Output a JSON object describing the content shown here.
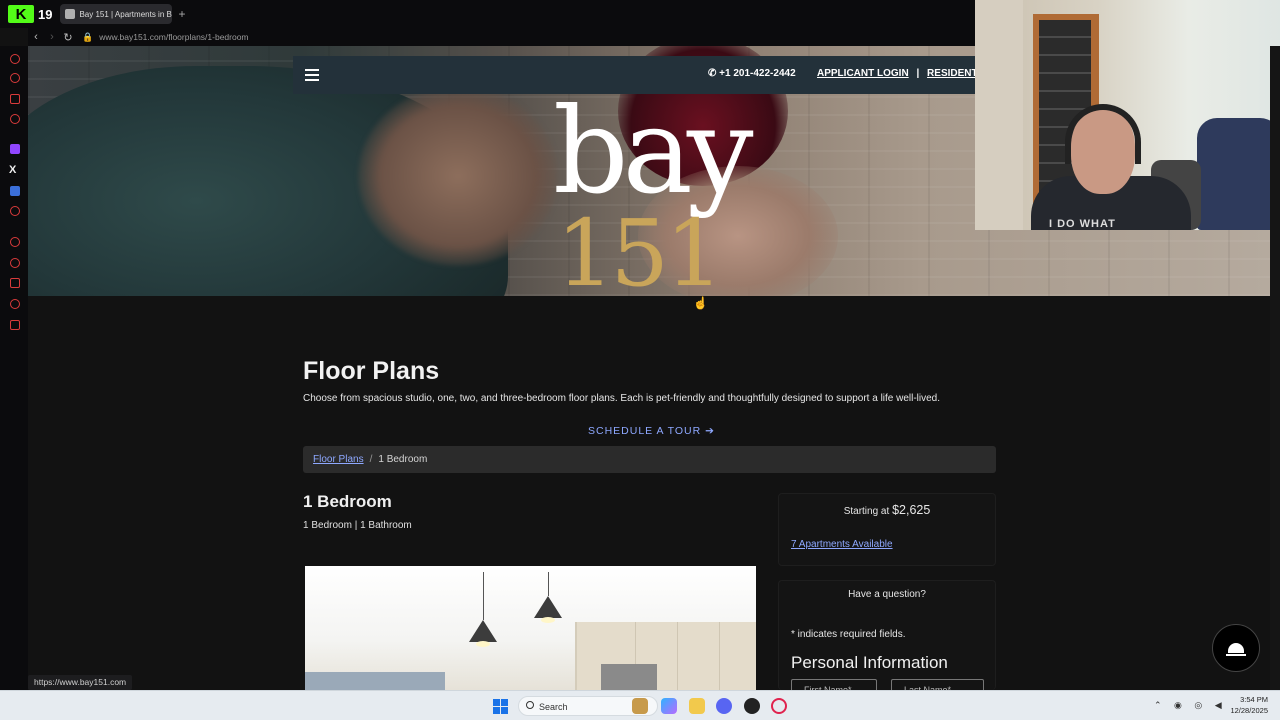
{
  "browser": {
    "kick_count": "19",
    "tab_title": "Bay 151 | Apartments in Be",
    "url": "www.bay151.com/floorplans/1-bedroom",
    "status_url": "https://www.bay151.com"
  },
  "header": {
    "phone": "+1 201-422-2442",
    "applicant_login": "APPLICANT LOGIN",
    "separator": "|",
    "resident_login": "RESIDENT LO"
  },
  "logo": {
    "word": "bay",
    "number": "151",
    "gold_color": "#c9a55a"
  },
  "page": {
    "title": "Floor Plans",
    "description": "Choose from spacious studio, one, two, and three-bedroom floor plans. Each is pet-friendly and thoughtfully designed to support a life well-lived.",
    "tour_button": "SCHEDULE A TOUR",
    "tour_arrow": "➔"
  },
  "breadcrumb": {
    "parent": "Floor Plans",
    "separator": "/",
    "current": "1 Bedroom"
  },
  "unit": {
    "title": "1 Bedroom",
    "subtitle": "1 Bedroom | 1 Bathroom",
    "starting_label": "Starting at",
    "price": "$2,625",
    "available_link": "7 Apartments Available"
  },
  "form": {
    "question": "Have a question?",
    "required_note": "* indicates required fields.",
    "section_title": "Personal Information",
    "first_name_placeholder": "First Name*",
    "last_name_placeholder": "Last Name*"
  },
  "taskbar": {
    "search_label": "Search",
    "time": "3:54 PM",
    "date": "12/28/2025"
  },
  "webcam": {
    "shirt_text": "I DO WHAT"
  },
  "colors": {
    "accent_link": "#8ea8ff",
    "header_bar": "#23313a",
    "kick_green": "#53fc18"
  }
}
